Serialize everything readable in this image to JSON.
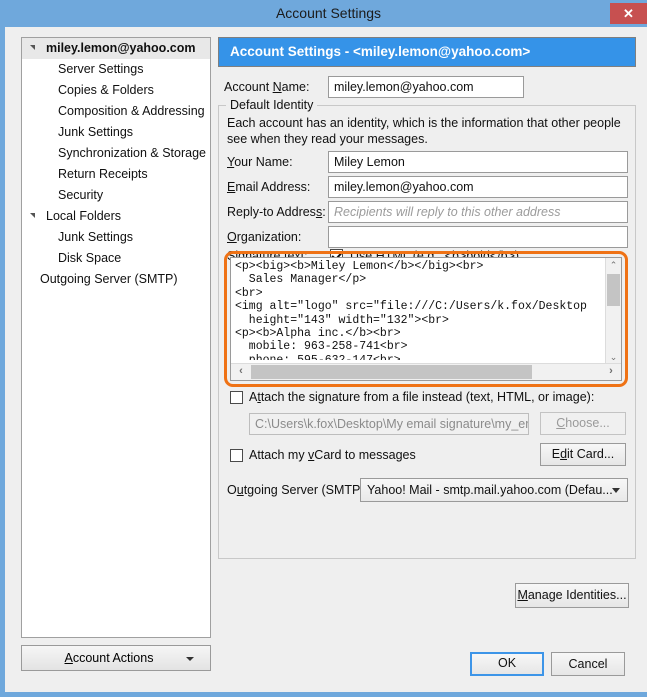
{
  "window": {
    "title": "Account Settings",
    "close_label": "✕"
  },
  "sidebar": {
    "items": [
      {
        "label": "miley.lemon@yahoo.com",
        "level": "root",
        "twisty": true,
        "selected": true
      },
      {
        "label": "Server Settings",
        "level": "1",
        "twisty": false,
        "selected": false
      },
      {
        "label": "Copies & Folders",
        "level": "1",
        "twisty": false,
        "selected": false
      },
      {
        "label": "Composition & Addressing",
        "level": "1",
        "twisty": false,
        "selected": false
      },
      {
        "label": "Junk Settings",
        "level": "1",
        "twisty": false,
        "selected": false
      },
      {
        "label": "Synchronization & Storage",
        "level": "1",
        "twisty": false,
        "selected": false
      },
      {
        "label": "Return Receipts",
        "level": "1",
        "twisty": false,
        "selected": false
      },
      {
        "label": "Security",
        "level": "1",
        "twisty": false,
        "selected": false
      },
      {
        "label": "Local Folders",
        "level": "root",
        "twisty": true,
        "selected": false
      },
      {
        "label": "Junk Settings",
        "level": "1",
        "twisty": false,
        "selected": false
      },
      {
        "label": "Disk Space",
        "level": "1",
        "twisty": false,
        "selected": false
      },
      {
        "label": "Outgoing Server (SMTP)",
        "level": "0",
        "twisty": false,
        "selected": false
      }
    ],
    "account_actions_label": "Account Actions",
    "account_actions_mnemonic": "A"
  },
  "main": {
    "header": "Account Settings - <miley.lemon@yahoo.com>",
    "account_name_label": "Account Name:",
    "account_name_label_pre": "Account ",
    "account_name_mnemonic": "N",
    "account_name_label_post": "ame:",
    "account_name_value": "miley.lemon@yahoo.com",
    "group_title": "Default Identity",
    "group_desc": "Each account has an identity, which is the information that other people see when they read your messages.",
    "your_name_label_pre": "",
    "your_name_mnemonic": "Y",
    "your_name_label_post": "our Name:",
    "your_name_value": "Miley Lemon",
    "email_label_pre": "",
    "email_mnemonic": "E",
    "email_label_post": "mail Address:",
    "email_value": "miley.lemon@yahoo.com",
    "replyto_label_pre": "Reply-to Addres",
    "replyto_mnemonic": "s",
    "replyto_label_post": ":",
    "replyto_placeholder": "Recipients will reply to this other address",
    "organization_label_pre": "",
    "organization_mnemonic": "O",
    "organization_label_post": "rganization:",
    "organization_value": "",
    "signature_label": "Signature text:",
    "signature_label_pre": "Signature te",
    "signature_mnemonic": "x",
    "signature_label_post": "t:",
    "use_html_label_pre": "Use HTM",
    "use_html_mnemonic": "L",
    "use_html_label_post": " (e.g., <b>bold</b>)",
    "use_html_checked": true,
    "signature_text": "<p><big><b>Miley Lemon</b></big><br>\n  Sales Manager</p>\n<br>\n<img alt=\"logo\" src=\"file:///C:/Users/k.fox/Desktop\n  height=\"143\" width=\"132\"><br>\n<p><b>Alpha inc.</b><br>\n  mobile: 963-258-741<br>\n  phone: 595-632-147<br>",
    "attach_file_label_pre": "A",
    "attach_file_mnemonic": "t",
    "attach_file_label_post": "tach the signature from a file instead (text, HTML, or image):",
    "attach_file_checked": false,
    "attach_file_path": "C:\\Users\\k.fox\\Desktop\\My email signature\\my_email_",
    "choose_label_pre": "",
    "choose_mnemonic": "C",
    "choose_label_post": "hoose...",
    "vcard_label_pre": "Attach my ",
    "vcard_mnemonic": "v",
    "vcard_label_post": "Card to messages",
    "vcard_checked": false,
    "edit_card_label_pre": "E",
    "edit_card_mnemonic": "d",
    "edit_card_label_post": "it Card...",
    "smtp_label_pre": "O",
    "smtp_mnemonic": "u",
    "smtp_label_post": "tgoing Server (SMTP):",
    "smtp_value": "Yahoo! Mail - smtp.mail.yahoo.com (Defau...",
    "manage_identities_pre": "",
    "manage_identities_mnemonic": "M",
    "manage_identities_post": "anage Identities..."
  },
  "footer": {
    "ok_label": "OK",
    "cancel_label": "Cancel"
  },
  "colors": {
    "titlebar": "#6fa8dc",
    "close_button": "#c75050",
    "pane_header": "#3593e8",
    "highlight_outline": "#ef7215",
    "default_button_border": "#3d95e8"
  },
  "icons": {
    "scroll_up": "⌃",
    "scroll_down": "⌄",
    "scroll_left": "‹",
    "scroll_right": "›"
  }
}
